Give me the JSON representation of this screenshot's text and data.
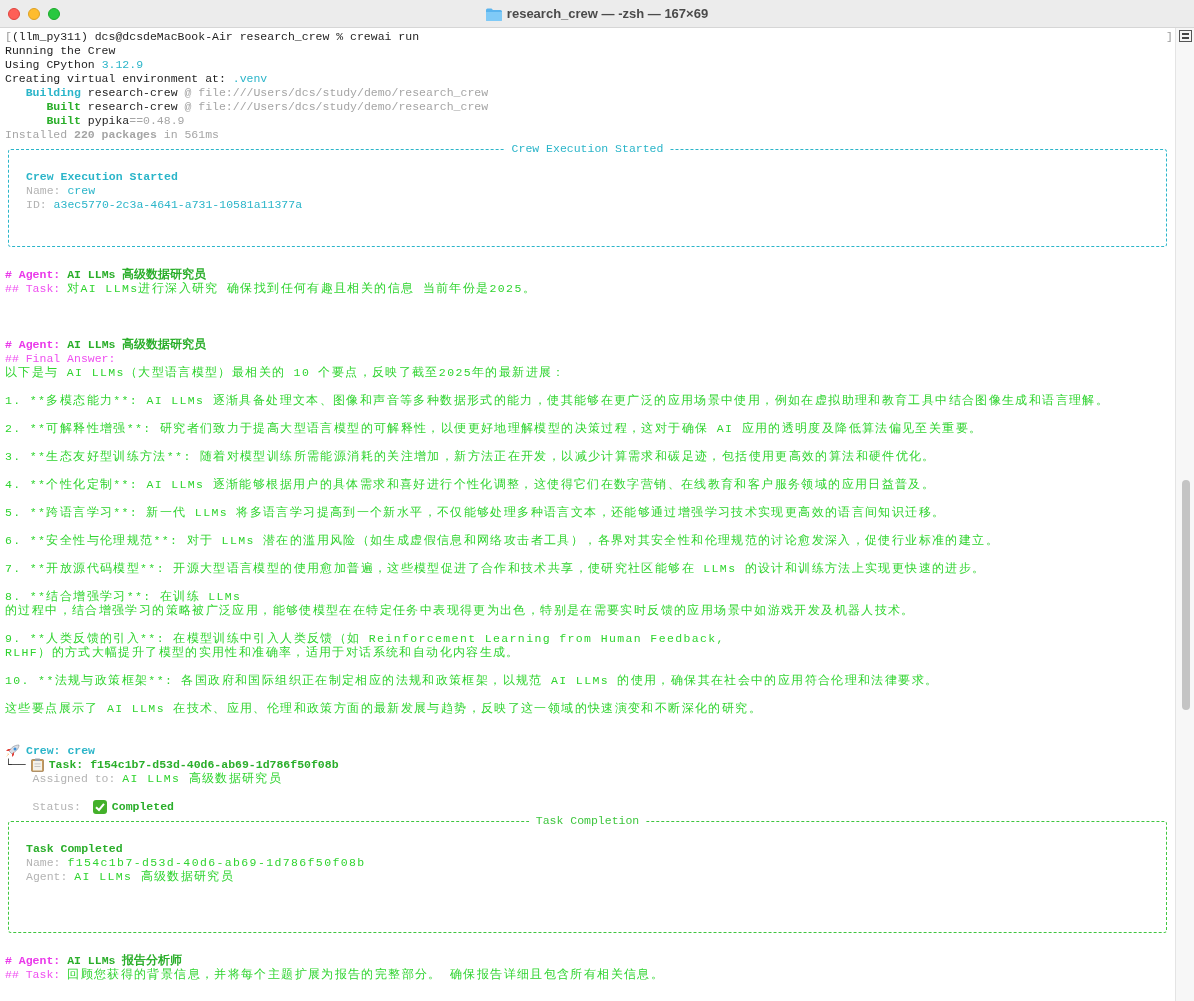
{
  "window": {
    "title": "research_crew — -zsh — 167×69"
  },
  "terminal": {
    "lines": [
      {
        "kind": "text",
        "segments": [
          {
            "kind": "marker",
            "text": "["
          },
          {
            "kind": "output",
            "text": "(llm_py311) dcs@dcsdeMacBook-Air research_crew % crewai run"
          }
        ]
      },
      {
        "kind": "text",
        "segments": [
          {
            "kind": "output",
            "text": "Running the Crew"
          }
        ]
      },
      {
        "kind": "text",
        "segments": [
          {
            "kind": "output",
            "text": "Using CPython "
          },
          {
            "kind": "highlight",
            "text": "3.12.9"
          }
        ]
      },
      {
        "kind": "text",
        "segments": [
          {
            "kind": "output",
            "text": "Creating virtual environment at: "
          },
          {
            "kind": "highlight",
            "text": ".venv"
          }
        ]
      },
      {
        "kind": "text",
        "segments": [
          {
            "kind": "title",
            "text": "   Building"
          },
          {
            "kind": "output",
            "text": " research-crew "
          },
          {
            "kind": "dim",
            "text": "@ file:///Users/dcs/study/demo/research_crew"
          }
        ]
      },
      {
        "kind": "text",
        "segments": [
          {
            "kind": "strong",
            "text": "      Built"
          },
          {
            "kind": "output",
            "text": " research-crew "
          },
          {
            "kind": "dim",
            "text": "@ file:///Users/dcs/study/demo/research_crew"
          }
        ]
      },
      {
        "kind": "text",
        "segments": [
          {
            "kind": "strong",
            "text": "      Built"
          },
          {
            "kind": "output",
            "text": " pypika"
          },
          {
            "kind": "dim",
            "text": "==0.48.9"
          }
        ]
      },
      {
        "kind": "text",
        "segments": [
          {
            "kind": "dim",
            "text": "Installed "
          },
          {
            "kind": "count",
            "text": "220 packages"
          },
          {
            "kind": "dim",
            "text": " in 561ms"
          }
        ]
      },
      {
        "kind": "panel",
        "title": "Crew Execution Started",
        "color": "#2bb5c9",
        "lines": [
          {
            "kind": "blank"
          },
          {
            "kind": "text",
            "segments": [
              {
                "kind": "title",
                "text": "Crew Execution Started"
              }
            ]
          },
          {
            "kind": "text",
            "segments": [
              {
                "kind": "label",
                "text": "Name: "
              },
              {
                "kind": "highlight",
                "text": "crew"
              }
            ]
          },
          {
            "kind": "text",
            "segments": [
              {
                "kind": "label",
                "text": "ID: "
              },
              {
                "kind": "highlight",
                "text": "a3ec5770-2c3a-4641-a731-10581a11377a"
              }
            ]
          },
          {
            "kind": "blank"
          },
          {
            "kind": "blank"
          }
        ]
      },
      {
        "kind": "blank"
      },
      {
        "kind": "text",
        "segments": [
          {
            "kind": "agent",
            "text": "# Agent: "
          },
          {
            "kind": "strong",
            "text": "AI LLMs 高级数据研究员"
          }
        ]
      },
      {
        "kind": "text",
        "segments": [
          {
            "kind": "section",
            "text": "## Task: "
          },
          {
            "kind": "answer",
            "text": "对AI LLMs进行深入研究 确保找到任何有趣且相关的信息 当前年份是2025。"
          }
        ]
      },
      {
        "kind": "blank"
      },
      {
        "kind": "blank"
      },
      {
        "kind": "blank"
      },
      {
        "kind": "text",
        "segments": [
          {
            "kind": "agent",
            "text": "# Agent: "
          },
          {
            "kind": "strong",
            "text": "AI LLMs 高级数据研究员"
          }
        ]
      },
      {
        "kind": "text",
        "segments": [
          {
            "kind": "section",
            "text": "## Final Answer:"
          }
        ]
      },
      {
        "kind": "text",
        "segments": [
          {
            "kind": "answer",
            "text": "以下是与 AI LLMs（大型语言模型）最相关的 10 个要点，反映了截至2025年的最新进展："
          }
        ]
      },
      {
        "kind": "blank"
      },
      {
        "kind": "text",
        "segments": [
          {
            "kind": "answer",
            "text": "1. **多模态能力**: AI LLMs 逐渐具备处理文本、图像和声音等多种数据形式的能力，使其能够在更广泛的应用场景中使用，例如在虚拟助理和教育工具中结合图像生成和语言理解。"
          }
        ]
      },
      {
        "kind": "blank"
      },
      {
        "kind": "text",
        "segments": [
          {
            "kind": "answer",
            "text": "2. **可解释性增强**: 研究者们致力于提高大型语言模型的可解释性，以便更好地理解模型的决策过程，这对于确保 AI 应用的透明度及降低算法偏见至关重要。"
          }
        ]
      },
      {
        "kind": "blank"
      },
      {
        "kind": "text",
        "segments": [
          {
            "kind": "answer",
            "text": "3. **生态友好型训练方法**: 随着对模型训练所需能源消耗的关注增加，新方法正在开发，以减少计算需求和碳足迹，包括使用更高效的算法和硬件优化。"
          }
        ]
      },
      {
        "kind": "blank"
      },
      {
        "kind": "text",
        "segments": [
          {
            "kind": "answer",
            "text": "4. **个性化定制**: AI LLMs 逐渐能够根据用户的具体需求和喜好进行个性化调整，这使得它们在数字营销、在线教育和客户服务领域的应用日益普及。"
          }
        ]
      },
      {
        "kind": "blank"
      },
      {
        "kind": "text",
        "segments": [
          {
            "kind": "answer",
            "text": "5. **跨语言学习**: 新一代 LLMs 将多语言学习提高到一个新水平，不仅能够处理多种语言文本，还能够通过增强学习技术实现更高效的语言间知识迁移。"
          }
        ]
      },
      {
        "kind": "blank"
      },
      {
        "kind": "text",
        "segments": [
          {
            "kind": "answer",
            "text": "6. **安全性与伦理规范**: 对于 LLMs 潜在的滥用风险（如生成虚假信息和网络攻击者工具），各界对其安全性和伦理规范的讨论愈发深入，促使行业标准的建立。"
          }
        ]
      },
      {
        "kind": "blank"
      },
      {
        "kind": "text",
        "segments": [
          {
            "kind": "answer",
            "text": "7. **开放源代码模型**: 开源大型语言模型的使用愈加普遍，这些模型促进了合作和技术共享，使研究社区能够在 LLMs 的设计和训练方法上实现更快速的进步。"
          }
        ]
      },
      {
        "kind": "blank"
      },
      {
        "kind": "text",
        "segments": [
          {
            "kind": "answer",
            "text": "8. **结合增强学习**: 在训练 LLMs"
          }
        ]
      },
      {
        "kind": "text",
        "segments": [
          {
            "kind": "answer",
            "text": "的过程中，结合增强学习的策略被广泛应用，能够使模型在在特定任务中表现得更为出色，特别是在需要实时反馈的应用场景中如游戏开发及机器人技术。"
          }
        ]
      },
      {
        "kind": "blank"
      },
      {
        "kind": "text",
        "segments": [
          {
            "kind": "answer",
            "text": "9. **人类反馈的引入**: 在模型训练中引入人类反馈（如 Reinforcement Learning from Human Feedback,"
          }
        ]
      },
      {
        "kind": "text",
        "segments": [
          {
            "kind": "answer",
            "text": "RLHF）的方式大幅提升了模型的实用性和准确率，适用于对话系统和自动化内容生成。"
          }
        ]
      },
      {
        "kind": "blank"
      },
      {
        "kind": "text",
        "segments": [
          {
            "kind": "answer",
            "text": "10. **法规与政策框架**: 各国政府和国际组织正在制定相应的法规和政策框架，以规范 AI LLMs 的使用，确保其在社会中的应用符合伦理和法律要求。"
          }
        ]
      },
      {
        "kind": "blank"
      },
      {
        "kind": "text",
        "segments": [
          {
            "kind": "answer",
            "text": "这些要点展示了 AI LLMs 在技术、应用、伦理和政策方面的最新发展与趋势，反映了这一领域的快速演变和不断深化的研究。"
          }
        ]
      },
      {
        "kind": "blank"
      },
      {
        "kind": "blank"
      },
      {
        "kind": "crew",
        "segments": [
          {
            "kind": "title",
            "text": "Crew: crew"
          }
        ]
      },
      {
        "kind": "task",
        "segments": [
          {
            "kind": "connector",
            "text": "└──"
          },
          {
            "kind": "strong",
            "text": "Task: f154c1b7-d53d-40d6-ab69-1d786f50f08b"
          }
        ]
      },
      {
        "kind": "text",
        "segments": [
          {
            "kind": "label",
            "text": "    Assigned to: "
          },
          {
            "kind": "answer",
            "text": "AI LLMs 高级数据研究员"
          }
        ]
      },
      {
        "kind": "blank"
      },
      {
        "kind": "status",
        "segments": [
          {
            "kind": "label",
            "text": "    Status: "
          },
          {
            "kind": "strong",
            "text": "Completed"
          }
        ]
      },
      {
        "kind": "panel",
        "title": "Task Completion",
        "color": "#3fc63f",
        "lines": [
          {
            "kind": "blank"
          },
          {
            "kind": "text",
            "segments": [
              {
                "kind": "strong",
                "text": "Task Completed"
              }
            ]
          },
          {
            "kind": "text",
            "segments": [
              {
                "kind": "label",
                "text": "Name: "
              },
              {
                "kind": "answer",
                "text": "f154c1b7-d53d-40d6-ab69-1d786f50f08b"
              }
            ]
          },
          {
            "kind": "text",
            "segments": [
              {
                "kind": "label",
                "text": "Agent: "
              },
              {
                "kind": "answer",
                "text": "AI LLMs 高级数据研究员"
              }
            ]
          },
          {
            "kind": "blank"
          },
          {
            "kind": "blank"
          },
          {
            "kind": "blank"
          }
        ]
      },
      {
        "kind": "blank"
      },
      {
        "kind": "text",
        "segments": [
          {
            "kind": "agent",
            "text": "# Agent: "
          },
          {
            "kind": "strong",
            "text": "AI LLMs 报告分析师"
          }
        ]
      },
      {
        "kind": "text",
        "segments": [
          {
            "kind": "section",
            "text": "## Task: "
          },
          {
            "kind": "answer",
            "text": "回顾您获得的背景信息，并将每个主题扩展为报告的完整部分。 确保报告详细且包含所有相关信息。"
          }
        ]
      }
    ]
  },
  "prompt_end_mark": "]"
}
